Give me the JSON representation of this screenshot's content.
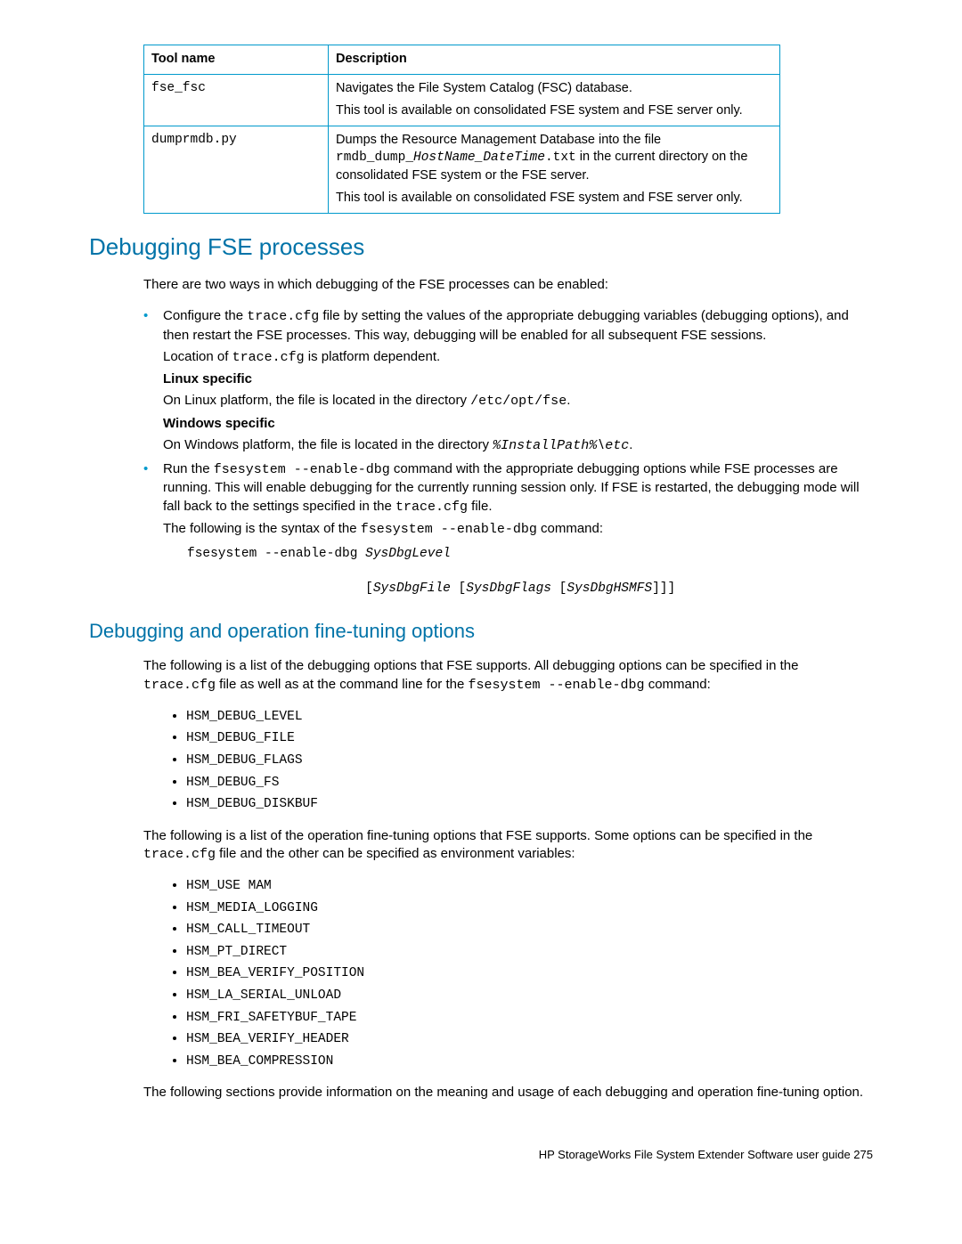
{
  "table": {
    "headers": {
      "tool": "Tool name",
      "desc": "Description"
    },
    "row1": {
      "tool": "fse_fsc",
      "p1": "Navigates the File System Catalog (FSC) database.",
      "p2": "This tool is available on consolidated FSE system and FSE server only."
    },
    "row2": {
      "tool": "dumprmdb.py",
      "p1a": "Dumps the Resource Management Database into the file ",
      "p1b": "rmdb_dump_",
      "p1c": "HostName_DateTime",
      "p1d": ".txt",
      "p1e": " in the current directory on the consolidated FSE system or the FSE server.",
      "p2": "This tool is available on consolidated FSE system and FSE server only."
    }
  },
  "h2_1": "Debugging FSE processes",
  "p_intro": "There are two ways in which debugging of the FSE processes can be enabled:",
  "b1": {
    "p1a": "Configure the ",
    "p1b": "trace.cfg",
    "p1c": " file by setting the values of the appropriate debugging variables (debugging options), and then restart the FSE processes. This way, debugging will be enabled for all subsequent FSE sessions.",
    "p2a": "Location of ",
    "p2b": "trace.cfg",
    "p2c": " is platform dependent.",
    "linux_h": "Linux specific",
    "linux_a": "On Linux platform, the file is located in the directory ",
    "linux_b": "/etc/opt/fse",
    "linux_c": ".",
    "win_h": "Windows specific",
    "win_a": "On Windows platform, the file is located in the directory ",
    "win_b": "%InstallPath%\\etc",
    "win_c": "."
  },
  "b2": {
    "p1a": "Run the ",
    "p1b": "fsesystem --enable-dbg",
    "p1c": " command with the appropriate debugging options while FSE processes are running. This will enable debugging for the currently running session only. If FSE is restarted, the debugging mode will fall back to the settings specified in the ",
    "p1d": "trace.cfg",
    "p1e": " file.",
    "p2a": "The following is the syntax of the ",
    "p2b": "fsesystem --enable-dbg",
    "p2c": " command:"
  },
  "code1": "fsesystem --enable-dbg ",
  "code1i": "SysDbgLevel",
  "code2pad": "                       [",
  "code2a": "SysDbgFile",
  "code2b": " [",
  "code2c": "SysDbgFlags",
  "code2d": " [",
  "code2e": "SysDbgHSMFS",
  "code2f": "]]]",
  "h3_1": "Debugging and operation fine-tuning options",
  "p_ft1a": "The following is a list of the debugging options that FSE supports. All debugging options can be specified in the ",
  "p_ft1b": "trace.cfg",
  "p_ft1c": " file as well as at the command line for the ",
  "p_ft1d": "fsesystem --enable-dbg",
  "p_ft1e": " command:",
  "list1": {
    "i0": "HSM_DEBUG_LEVEL",
    "i1": "HSM_DEBUG_FILE",
    "i2": "HSM_DEBUG_FLAGS",
    "i3": "HSM_DEBUG_FS",
    "i4": "HSM_DEBUG_DISKBUF"
  },
  "p_ft2a": "The following is a list of the operation fine-tuning options that FSE supports. Some options can be specified in the ",
  "p_ft2b": "trace.cfg",
  "p_ft2c": " file and the other can be specified as environment variables:",
  "list2": {
    "i0": "HSM_USE MAM",
    "i1": "HSM_MEDIA_LOGGING",
    "i2": "HSM_CALL_TIMEOUT",
    "i3": "HSM_PT_DIRECT",
    "i4": "HSM_BEA_VERIFY_POSITION",
    "i5": "HSM_LA_SERIAL_UNLOAD",
    "i6": "HSM_FRI_SAFETYBUF_TAPE",
    "i7": "HSM_BEA_VERIFY_HEADER",
    "i8": "HSM_BEA_COMPRESSION"
  },
  "p_final": "The following sections provide information on the meaning and usage of each debugging and operation fine-tuning option.",
  "footer": "HP StorageWorks File System Extender Software user guide   275"
}
